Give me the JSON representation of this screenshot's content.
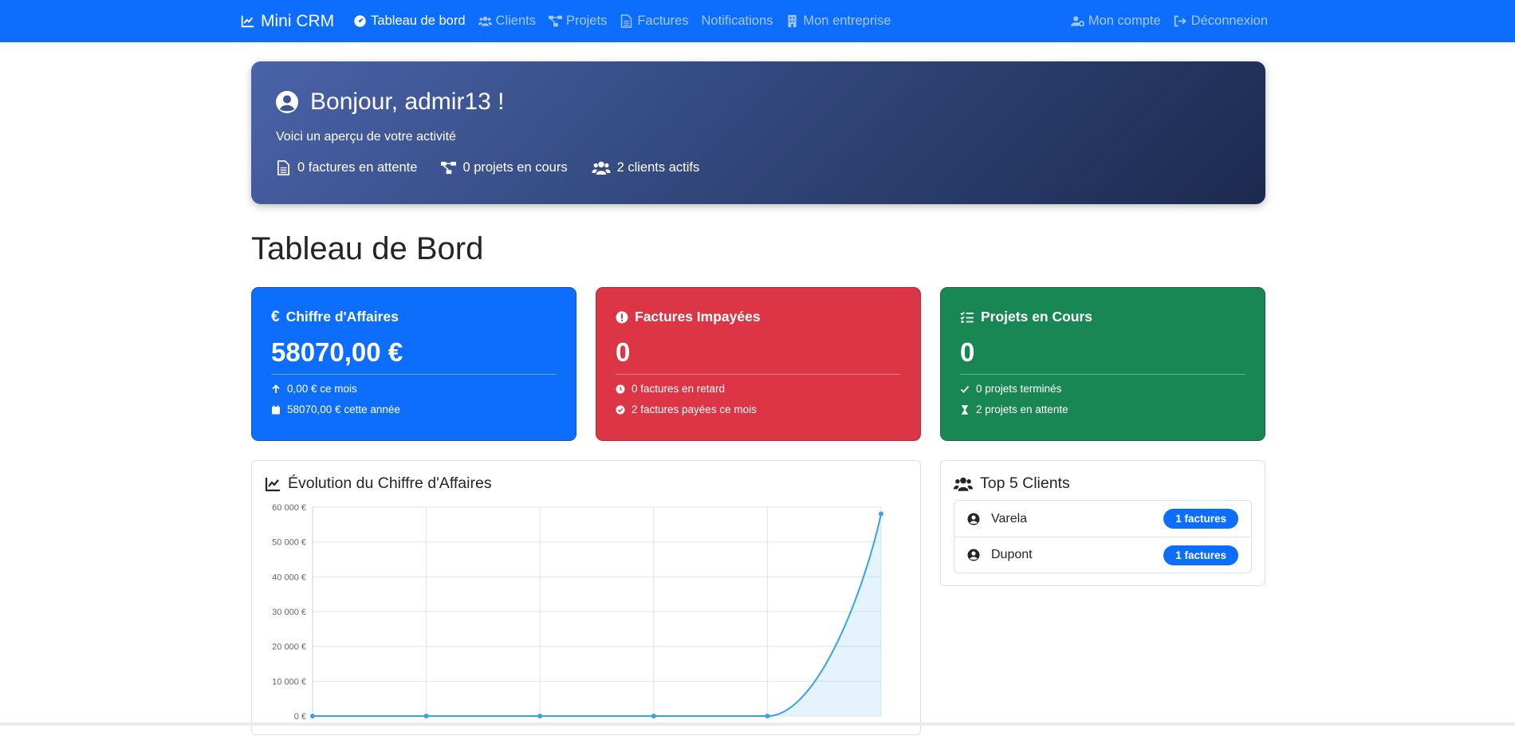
{
  "navbar": {
    "brand": "Mini CRM",
    "links": [
      {
        "label": "Tableau de bord",
        "icon": "dashboard-icon",
        "active": true
      },
      {
        "label": "Clients",
        "icon": "users-icon"
      },
      {
        "label": "Projets",
        "icon": "project-diagram-icon"
      },
      {
        "label": "Factures",
        "icon": "invoice-icon"
      },
      {
        "label": "Notifications",
        "icon": ""
      },
      {
        "label": "Mon entreprise",
        "icon": "building-icon"
      }
    ],
    "right_links": [
      {
        "label": "Mon compte",
        "icon": "user-cog-icon"
      },
      {
        "label": "Déconnexion",
        "icon": "logout-icon"
      }
    ],
    "color": "#0d6efd"
  },
  "welcome": {
    "title": "Bonjour, admir13 !",
    "subtitle": "Voici un aperçu de votre activité",
    "stats": [
      {
        "text": "0 factures en attente",
        "icon": "invoice-icon"
      },
      {
        "text": "0 projets en cours",
        "icon": "project-diagram-icon"
      },
      {
        "text": "2 clients actifs",
        "icon": "users-icon"
      }
    ]
  },
  "page_title": "Tableau de Bord",
  "cards": {
    "revenue": {
      "title": "Chiffre d'Affaires",
      "value": "58070,00 €",
      "line1": "0,00 € ce mois",
      "line2": "58070,00 € cette année",
      "color": "#0d6efd"
    },
    "unpaid": {
      "title": "Factures Impayées",
      "value": "0",
      "line1": "0 factures en retard",
      "line2": "2 factures payées ce mois",
      "color": "#dc3545"
    },
    "projects": {
      "title": "Projets en Cours",
      "value": "0",
      "line1": "0 projets terminés",
      "line2": "2 projets en attente",
      "color": "#198754"
    }
  },
  "chart_panel": {
    "title": "Évolution du Chiffre d'Affaires"
  },
  "chart_data": {
    "type": "area",
    "title": "Évolution du Chiffre d'Affaires",
    "x": [
      1,
      2,
      3,
      4,
      5,
      6
    ],
    "series": [
      {
        "values": [
          0,
          0,
          0,
          0,
          0,
          58070
        ],
        "color": "#36a2eb"
      }
    ],
    "ylim": [
      0,
      60000
    ],
    "yticks": [
      0,
      10000,
      20000,
      30000,
      40000,
      50000,
      60000
    ],
    "ytick_labels": [
      "0 €",
      "10 000 €",
      "20 000 €",
      "30 000 €",
      "40 000 €",
      "50 000 €",
      "60 000 €"
    ],
    "grid": true
  },
  "top_clients": {
    "title": "Top 5 Clients",
    "items": [
      {
        "name": "Varela",
        "badge": "1 factures"
      },
      {
        "name": "Dupont",
        "badge": "1 factures"
      }
    ]
  }
}
